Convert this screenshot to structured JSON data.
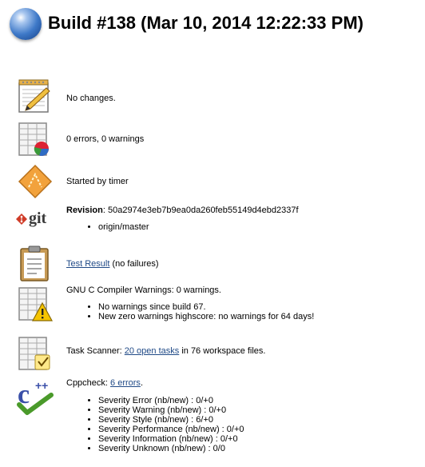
{
  "header": {
    "title": "Build #138 (Mar 10, 2014 12:22:33 PM)"
  },
  "changes": {
    "text": "No changes."
  },
  "warnings_summary": {
    "text": "0 errors, 0 warnings"
  },
  "cause": {
    "text": "Started by timer"
  },
  "git": {
    "logo_text": "git",
    "revision_label": "Revision",
    "revision_value": ": 50a2974e3eb7b9ea0da260feb55149d4ebd2337f",
    "branches": [
      "origin/master"
    ]
  },
  "tests": {
    "link": "Test Result",
    "suffix": " (no failures)"
  },
  "gcc": {
    "text": "GNU C Compiler Warnings: 0 warnings.",
    "items": [
      "No warnings since build 67.",
      "New zero warnings highscore: no warnings for 64 days!"
    ]
  },
  "tasks": {
    "prefix": "Task Scanner: ",
    "link": "20 open tasks",
    "suffix": " in 76 workspace files."
  },
  "cppcheck": {
    "prefix": "Cppcheck: ",
    "link": "6 errors",
    "suffix": ".",
    "items": [
      "Severity Error (nb/new) : 0/+0",
      "Severity Warning (nb/new) : 0/+0",
      "Severity Style (nb/new) : 6/+0",
      "Severity Performance (nb/new) : 0/+0",
      "Severity Information (nb/new) : 0/+0",
      "Severity Unknown (nb/new) : 0/0"
    ]
  }
}
